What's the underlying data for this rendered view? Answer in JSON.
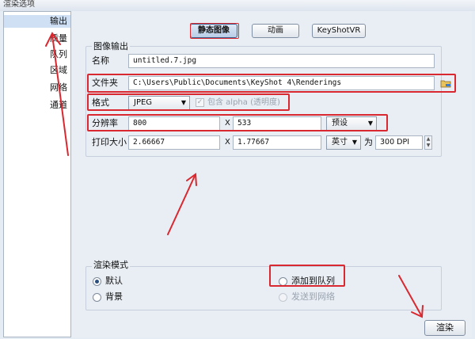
{
  "window": {
    "title": "渲染选项"
  },
  "sidebar": {
    "items": [
      {
        "label": "输出"
      },
      {
        "label": "质量"
      },
      {
        "label": "队列"
      },
      {
        "label": "区域"
      },
      {
        "label": "网络"
      },
      {
        "label": "通道"
      }
    ]
  },
  "tabs": [
    {
      "label": "静态图像"
    },
    {
      "label": "动画"
    },
    {
      "label": "KeyShotVR"
    }
  ],
  "image_output": {
    "group_title": "图像输出",
    "name_label": "名称",
    "name_value": "untitled.7.jpg",
    "folder_label": "文件夹",
    "folder_value": "C:\\Users\\Public\\Documents\\KeyShot 4\\Renderings",
    "format_label": "格式",
    "format_value": "JPEG",
    "alpha_label": "包含 alpha (透明度)",
    "resolution_label": "分辨率",
    "res_width": "800",
    "res_x": "X",
    "res_height": "533",
    "preset_label": "预设",
    "print_label": "打印大小",
    "print_width": "2.66667",
    "print_x": "X",
    "print_height": "1.77667",
    "unit_value": "英寸",
    "for_label": "为",
    "dpi_value": "300 DPI"
  },
  "render_mode": {
    "group_title": "渲染模式",
    "default_label": "默认",
    "background_label": "背景",
    "queue_label": "添加到队列",
    "network_label": "发送到网络"
  },
  "footer": {
    "render_label": "渲染"
  },
  "colors": {
    "annotation": "#d9282f",
    "accent": "#3a5d8c"
  }
}
